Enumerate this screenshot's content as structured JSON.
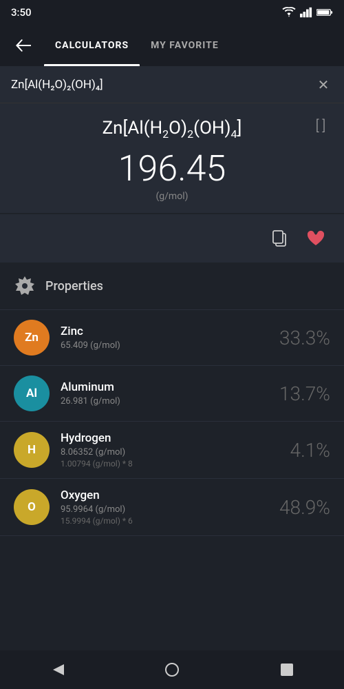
{
  "statusBar": {
    "time": "3:50"
  },
  "nav": {
    "tabs": [
      {
        "id": "calculators",
        "label": "CALCULATORS",
        "active": true
      },
      {
        "id": "my-favorite",
        "label": "MY FAVORITE",
        "active": false
      }
    ]
  },
  "search": {
    "value": "Zn[Al(H₂O)₂(OH)₄]",
    "placeholder": "Enter formula"
  },
  "formula": {
    "display": "Zn[Al(H₂O)₂(OH)₄]",
    "molarMass": "196.45",
    "unit": "(g/mol)"
  },
  "properties": {
    "title": "Properties",
    "elements": [
      {
        "symbol": "Zn",
        "name": "Zinc",
        "mass": "65.409 (g/mol)",
        "detail": "",
        "percent": "33.3%",
        "color": "#e07b20"
      },
      {
        "symbol": "Al",
        "name": "Aluminum",
        "mass": "26.981 (g/mol)",
        "detail": "",
        "percent": "13.7%",
        "color": "#1a8fa0"
      },
      {
        "symbol": "H",
        "name": "Hydrogen",
        "mass": "8.06352 (g/mol)",
        "detail": "1.00794 (g/mol) * 8",
        "percent": "4.1%",
        "color": "#c9a82a"
      },
      {
        "symbol": "O",
        "name": "Oxygen",
        "mass": "95.9964 (g/mol)",
        "detail": "15.9994 (g/mol) * 6",
        "percent": "48.9%",
        "color": "#c9a82a"
      }
    ]
  },
  "icons": {
    "back": "←",
    "clear": "✕",
    "bracket": "[ ]",
    "copy": "⧉",
    "heart": "♥",
    "navBack": "◀",
    "navHome": "●",
    "navRecent": "■"
  }
}
